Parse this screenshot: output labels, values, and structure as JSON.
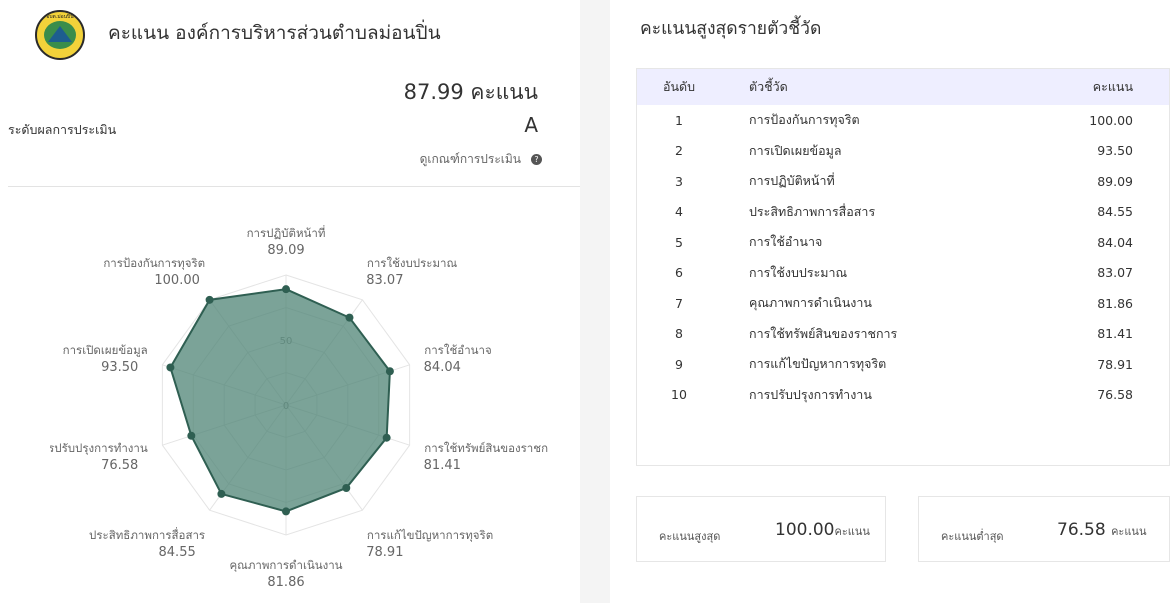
{
  "header": {
    "title": "คะแนน องค์การบริหารส่วนตำบลม่อนปิ่น",
    "logo_text": "อบต.ม่อนปิ่น"
  },
  "summary": {
    "score_text": "87.99 คะแนน",
    "grade_label": "ระดับผลการประเมิน",
    "grade": "A",
    "criteria_link": "ดูเกณฑ์การประเมิน",
    "help_icon": "?"
  },
  "radar": {
    "max": 100,
    "ring_labels": [
      "50",
      "0"
    ],
    "fill_color": "#4f8475",
    "stroke_color": "#2f5f52",
    "axes": [
      {
        "name": "การปฏิบัติหน้าที่",
        "value": 89.09,
        "value_text": "89.09"
      },
      {
        "name": "การใช้งบประมาณ",
        "value": 83.07,
        "value_text": "83.07"
      },
      {
        "name": "การใช้อำนาจ",
        "value": 84.04,
        "value_text": "84.04"
      },
      {
        "name": "การใช้ทรัพย์สินของราชก",
        "value": 81.41,
        "value_text": "81.41"
      },
      {
        "name": "การแก้ไขปัญหาการทุจริต",
        "value": 78.91,
        "value_text": "78.91"
      },
      {
        "name": "คุณภาพการดำเนินงาน",
        "value": 81.86,
        "value_text": "81.86"
      },
      {
        "name": "ประสิทธิภาพการสื่อสาร",
        "value": 84.55,
        "value_text": "84.55"
      },
      {
        "name": "การปรับปรุงการทำงาน",
        "value": 76.58,
        "value_text": "76.58"
      },
      {
        "name": "การเปิดเผยข้อมูล",
        "value": 93.5,
        "value_text": "93.50"
      },
      {
        "name": "การป้องกันการทุจริต",
        "value": 100,
        "value_text": "100.00"
      }
    ]
  },
  "ranking": {
    "title": "คะแนนสูงสุดรายตัวชี้วัด",
    "headers": {
      "rank": "อันดับ",
      "indicator": "ตัวชี้วัด",
      "score": "คะแนน"
    },
    "rows": [
      {
        "rank": "1",
        "indicator": "การป้องกันการทุจริต",
        "score": "100.00"
      },
      {
        "rank": "2",
        "indicator": "การเปิดเผยข้อมูล",
        "score": "93.50"
      },
      {
        "rank": "3",
        "indicator": "การปฏิบัติหน้าที่",
        "score": "89.09"
      },
      {
        "rank": "4",
        "indicator": "ประสิทธิภาพการสื่อสาร",
        "score": "84.55"
      },
      {
        "rank": "5",
        "indicator": "การใช้อำนาจ",
        "score": "84.04"
      },
      {
        "rank": "6",
        "indicator": "การใช้งบประมาณ",
        "score": "83.07"
      },
      {
        "rank": "7",
        "indicator": "คุณภาพการดำเนินงาน",
        "score": "81.86"
      },
      {
        "rank": "8",
        "indicator": "การใช้ทรัพย์สินของราชการ",
        "score": "81.41"
      },
      {
        "rank": "9",
        "indicator": "การแก้ไขปัญหาการทุจริต",
        "score": "78.91"
      },
      {
        "rank": "10",
        "indicator": "การปรับปรุงการทำงาน",
        "score": "76.58"
      }
    ]
  },
  "stats": {
    "max_label": "คะแนนสูงสุด",
    "max_value": "100.00",
    "max_unit": "คะแนน",
    "min_label": "คะแนนต่ำสุด",
    "min_value": "76.58",
    "min_unit": "คะแนน"
  }
}
